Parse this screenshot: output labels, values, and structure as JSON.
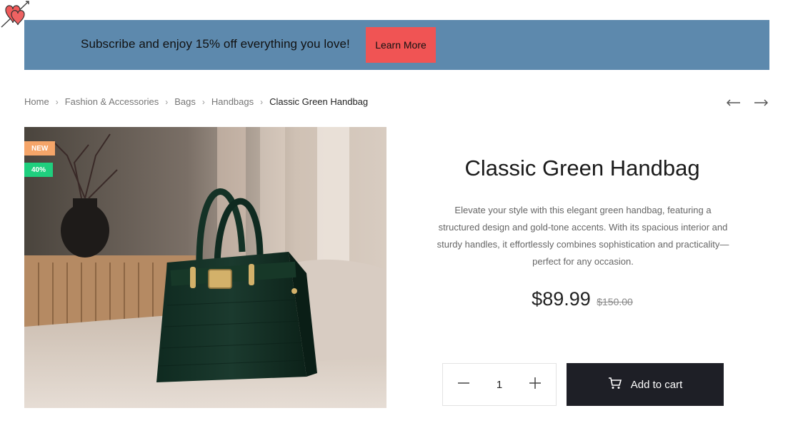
{
  "banner": {
    "text": "Subscribe and enjoy 15% off everything you love!",
    "button_label": "Learn More",
    "bg_color": "#5d89ad",
    "button_color": "#f05454",
    "icon": "heart-arrow-icon"
  },
  "breadcrumb": {
    "items": [
      "Home",
      "Fashion & Accessories",
      "Bags",
      "Handbags"
    ],
    "current": "Classic Green Handbag"
  },
  "nav": {
    "prev_icon": "arrow-left-icon",
    "next_icon": "arrow-right-icon"
  },
  "product": {
    "badges": {
      "new": "NEW",
      "discount": "40%"
    },
    "badge_colors": {
      "new": "#f5a569",
      "discount": "#1fcf7e"
    },
    "title": "Classic Green Handbag",
    "description": "Elevate your style with this elegant green handbag, featuring a structured design and gold-tone accents. With its spacious interior and sturdy handles, it effortlessly combines sophistication and practicality—perfect for any occasion.",
    "price": "$89.99",
    "old_price": "$150.00",
    "quantity": "1",
    "add_to_cart": "Add to cart",
    "cart_icon": "cart-icon"
  }
}
